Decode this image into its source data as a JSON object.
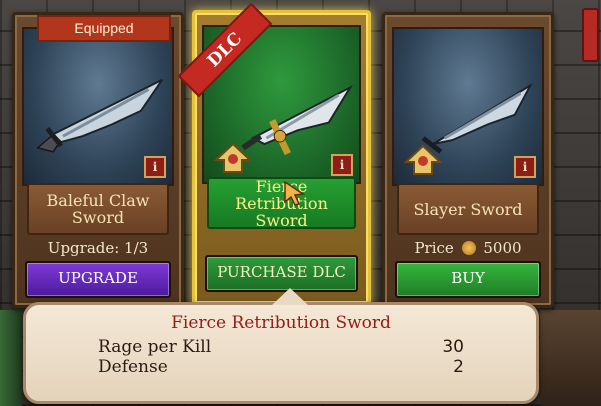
{
  "cards": [
    {
      "tag": "Equipped",
      "name_line1": "Baleful Claw",
      "name_line2": "Sword",
      "status": "Upgrade: 1/3",
      "button": "UPGRADE",
      "info": "i"
    },
    {
      "ribbon": "DLC",
      "name_line1": "Fierce Retribution",
      "name_line2": "Sword",
      "button": "PURCHASE DLC",
      "info": "i"
    },
    {
      "name_line1": "Slayer Sword",
      "name_line2": "",
      "price_label": "Price",
      "price_value": "5000",
      "button": "BUY",
      "info": "i"
    }
  ],
  "tooltip": {
    "title": "Fierce Retribution Sword",
    "stats": [
      {
        "label": "Rage per Kill",
        "value": "30"
      },
      {
        "label": "Defense",
        "value": "2"
      }
    ]
  },
  "colors": {
    "accent_gold": "#e5c23a",
    "tooltip_title": "#951b16",
    "upgrade": "#7e3bd6",
    "buy": "#37b53e"
  },
  "icons": [
    "info-icon",
    "rank-emblem-icon",
    "coin-icon",
    "pointer-cursor-icon"
  ]
}
